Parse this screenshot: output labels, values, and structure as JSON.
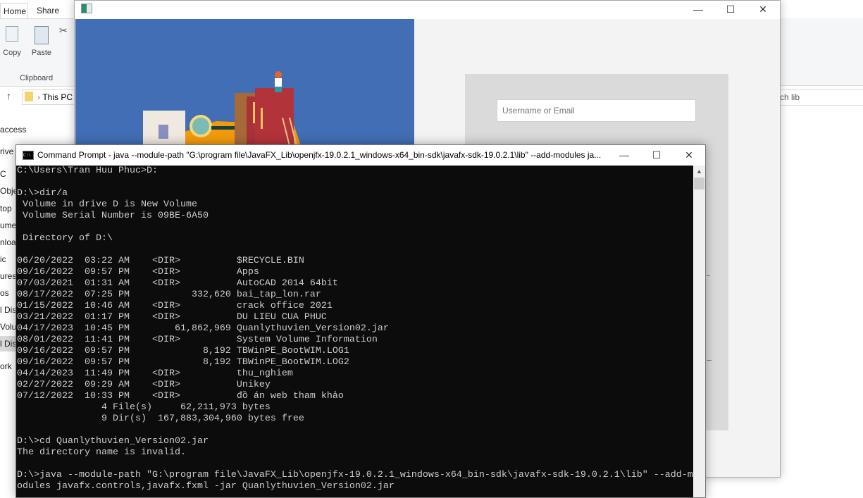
{
  "explorer": {
    "tabs": [
      "Home",
      "Share"
    ],
    "clipboard": {
      "copy": "Copy",
      "paste": "Paste",
      "group": "Clipboard"
    },
    "address": "This PC",
    "search_placeholder": "ch lib",
    "sidebar": [
      "access",
      "rive",
      "C",
      "Objec",
      "top",
      "ume",
      "nloa",
      "ic",
      "ures",
      "os",
      "l Dis",
      "Volu",
      "l Dis",
      "ork"
    ],
    "selected_sidebar_index": 12
  },
  "fxapp": {
    "username_placeholder": "Username or Email",
    "accent": "#416eb4"
  },
  "cmd": {
    "title": "Command Prompt - java  --module-path \"G:\\program file\\JavaFX_Lib\\openjfx-19.0.2.1_windows-x64_bin-sdk\\javafx-sdk-19.0.2.1\\lib\" --add-modules ja...",
    "lines": [
      "C:\\Users\\Tran Huu Phuc>D:",
      "",
      "D:\\>dir/a",
      " Volume in drive D is New Volume",
      " Volume Serial Number is 09BE-6A50",
      "",
      " Directory of D:\\",
      "",
      "06/20/2022  03:22 AM    <DIR>          $RECYCLE.BIN",
      "09/16/2022  09:57 PM    <DIR>          Apps",
      "07/03/2021  01:31 AM    <DIR>          AutoCAD 2014 64bit",
      "08/17/2022  07:25 PM           332,620 bai_tap_lon.rar",
      "01/15/2022  10:46 AM    <DIR>          crack office 2021",
      "03/21/2022  01:17 PM    <DIR>          DU LIEU CUA PHUC",
      "04/17/2023  10:45 PM        61,862,969 Quanlythuvien_Version02.jar",
      "08/01/2022  11:41 PM    <DIR>          System Volume Information",
      "09/16/2022  09:57 PM             8,192 TBWinPE_BootWIM.LOG1",
      "09/16/2022  09:57 PM             8,192 TBWinPE_BootWIM.LOG2",
      "04/14/2023  11:49 PM    <DIR>          thu_nghiem",
      "02/27/2022  09:29 AM    <DIR>          Unikey",
      "07/12/2022  10:33 PM    <DIR>          đồ án web tham khảo",
      "               4 File(s)     62,211,973 bytes",
      "               9 Dir(s)  167,883,304,960 bytes free",
      "",
      "D:\\>cd Quanlythuvien_Version02.jar",
      "The directory name is invalid.",
      "",
      "D:\\>java --module-path \"G:\\program file\\JavaFX_Lib\\openjfx-19.0.2.1_windows-x64_bin-sdk\\javafx-sdk-19.0.2.1\\lib\" --add-m",
      "odules javafx.controls,javafx.fxml -jar Quanlythuvien_Version02.jar"
    ]
  },
  "window_controls": {
    "minimize": "—",
    "maximize": "☐",
    "close": "✕"
  }
}
